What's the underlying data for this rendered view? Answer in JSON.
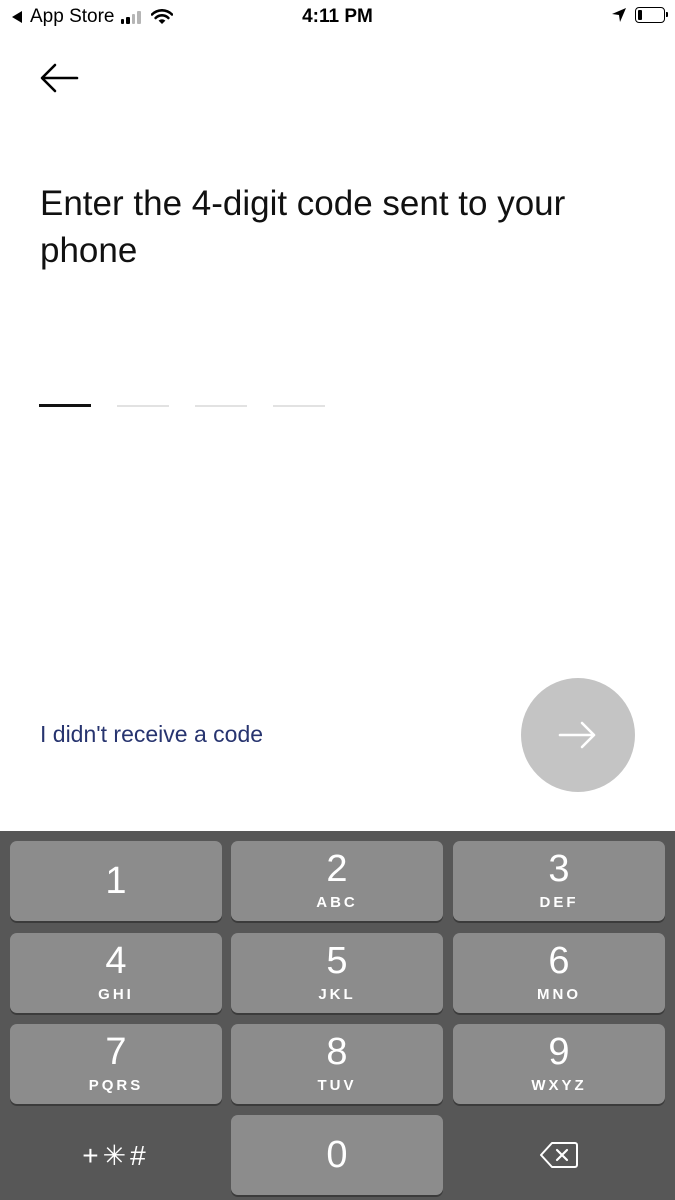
{
  "status_bar": {
    "back_app": "App Store",
    "time": "4:11 PM"
  },
  "page": {
    "title": "Enter the 4-digit code sent to your phone",
    "code_length": 4,
    "resend_label": "I didn't receive a code",
    "next_button_state": "disabled"
  },
  "keypad": {
    "keys": [
      {
        "digit": "1",
        "letters": ""
      },
      {
        "digit": "2",
        "letters": "ABC"
      },
      {
        "digit": "3",
        "letters": "DEF"
      },
      {
        "digit": "4",
        "letters": "GHI"
      },
      {
        "digit": "5",
        "letters": "JKL"
      },
      {
        "digit": "6",
        "letters": "MNO"
      },
      {
        "digit": "7",
        "letters": "PQRS"
      },
      {
        "digit": "8",
        "letters": "TUV"
      },
      {
        "digit": "9",
        "letters": "WXYZ"
      },
      {
        "digit": "0",
        "letters": ""
      }
    ],
    "symbols_label": "+✳#"
  },
  "icons": {
    "back": "arrow-left-icon",
    "next": "arrow-right-icon",
    "delete": "backspace-icon",
    "location": "location-arrow-icon",
    "wifi": "wifi-icon",
    "signal": "signal-icon",
    "battery": "battery-icon"
  },
  "colors": {
    "link": "#27346f",
    "next_button_disabled": "#c4c4c4",
    "keypad_background": "#575757",
    "key_background": "#8c8c8c"
  }
}
